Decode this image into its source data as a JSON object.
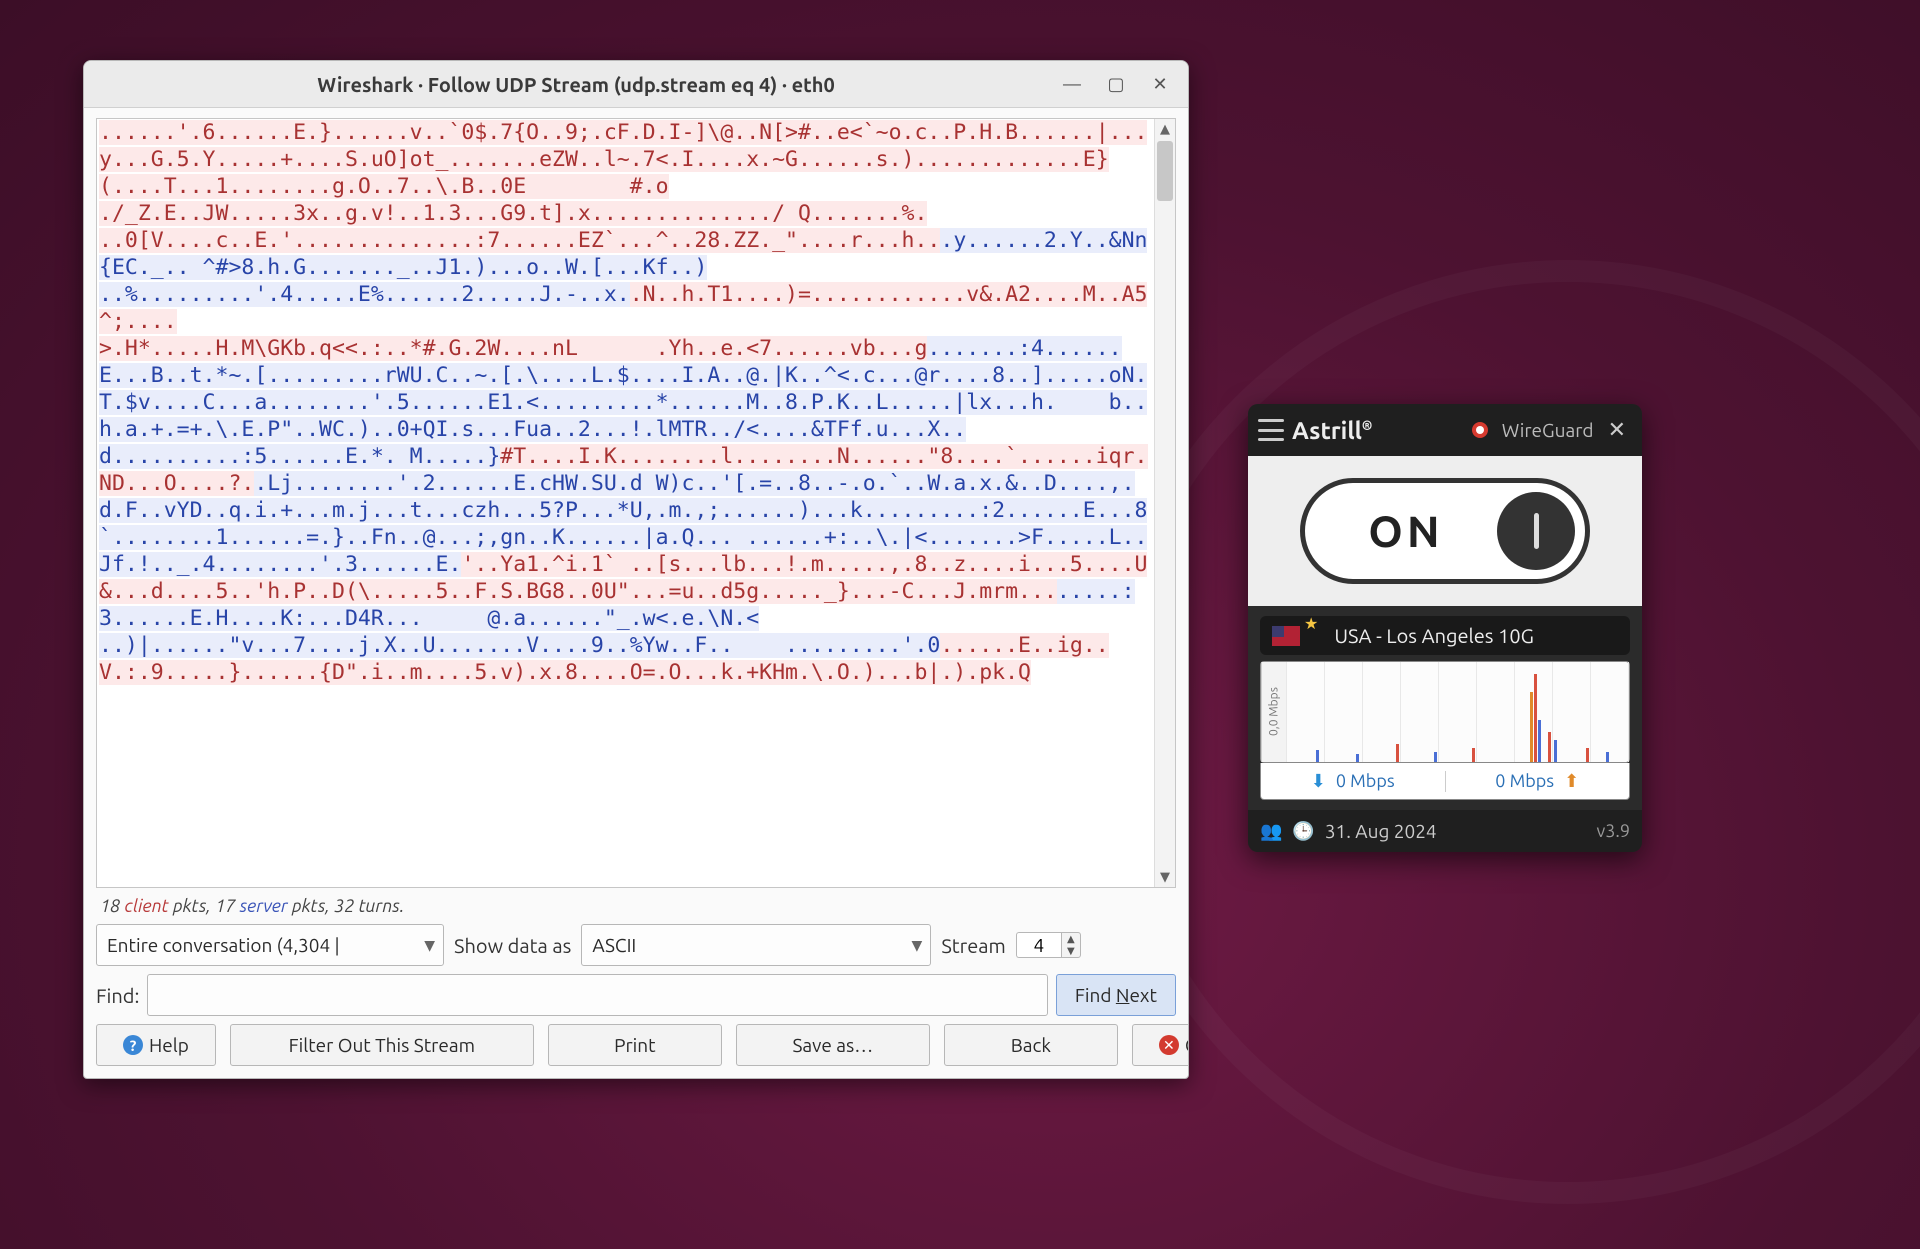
{
  "wireshark": {
    "title": "Wireshark · Follow UDP Stream (udp.stream eq 4) · eth0",
    "segments": [
      {
        "who": "cli",
        "text": "......'.6......E.}......v..`0$.7{O..9;.cF.D.I-]\\@..N[>#..e<`~o.c..P.H.B......|...y...G.5.Y.....+....S.uO]ot_.......eZW..l~.7<.I....x.~G......s.).............E}(....T...1........g.O..7..\\.B..0E        #.o\n./_Z.E..JW.....3x..g.v!..1.3...G9.t].x............../ Q.......%.\n..0[V....c..E.'..............:7......EZ`...^..28.ZZ._\"....r...h.."
      },
      {
        "who": "srv",
        "text": ".y......2.Y..&Nn{EC._.. ^#>8.h.G......._..J1.)...o..W.[...Kf..)\n..%.........'.4.....E%......2.....J.-..x."
      },
      {
        "who": "cli",
        "text": ".N..h.T1....)=............v&.A2....M..A5^;....\n>.H*.....H.M\\GKb.q<<.:..*#.G.2W....nL      .Yh..e.<7......vb...g"
      },
      {
        "who": "srv",
        "text": ".......:4......E...B..t.*~.[.........rWU.C..~.[.\\....L.$....I.A..@.|K..^<.c...@r....8..].....oN.T.$v....C...a........'.5......E1.<.........*......M..8.P.K..L.....|lx...h.    b..h.a.+.=+.\\.E.P\"..WC.)..0+QI.s...Fua..2...!.lMTR../<....&TFf.u...X..\nd..........:5......E.*. M.....}"
      },
      {
        "who": "cli",
        "text": "#T....I.K........l........N......\"8....`......iqr.ND...O....?."
      },
      {
        "who": "srv",
        "text": ".Lj........'.2......E.cHW.SU.d W)c..'[.=..8..-.o.`..W.a.x.&..D....,.d.F..vYD..q.i.+...m.j...t...czh...5?P...*U,.m.,;......)...k.........:2......E...8`........1......=.}..Fn..@...;,gn..K......|a.Q... ......+:..\\.|<.......>F.....L..Jf.!.._.4........'.3......E."
      },
      {
        "who": "cli",
        "text": "'..Ya1.^i.1` ..[s...lb...!.m.....,.8..z....i...5....U&...d....5..'h.P..D(\\.....5..F.S.BG8..0U\"...=u..d5g....._}...-C...J.mrm..."
      },
      {
        "who": "srv",
        "text": ".....:3......E.H....K:...D4R...     @.a......\"_.w<.e.\\N.<\n..)|......\"v...7....j.X..U.......V....9..%Yw..F..    .........'.0"
      },
      {
        "who": "cli",
        "text": "......E..ig..V.:.9.....}......{D\".i..m....5.v).x.8....O=.O...k.+KHm.\\.O.)...b|.).pk.Q"
      }
    ],
    "counts": {
      "client_pkts": "18",
      "client_word": "client",
      "mid1": " pkts, ",
      "server_pkts": "17",
      "server_word": "server",
      "tail": " pkts, 32 turns."
    },
    "conversation_select": "Entire conversation (4,304 |",
    "show_as_label": "Show data as",
    "encoding_select": "ASCII",
    "stream_label": "Stream",
    "stream_value": "4",
    "find_label": "Find:",
    "find_next": "Find Next",
    "buttons": {
      "help": "Help",
      "filter_out": "Filter Out This Stream",
      "print": "Print",
      "save_as": "Save as…",
      "back": "Back",
      "close": "Close"
    }
  },
  "astrill": {
    "brand": "Astrill",
    "proto": "WireGuard",
    "switch_state": "ON",
    "server": "USA - Los Angeles 10G",
    "yaxis": "0,0 Mbps",
    "down": "0 Mbps",
    "up": "0 Mbps",
    "date": "31. Aug 2024",
    "version": "v3.9"
  }
}
